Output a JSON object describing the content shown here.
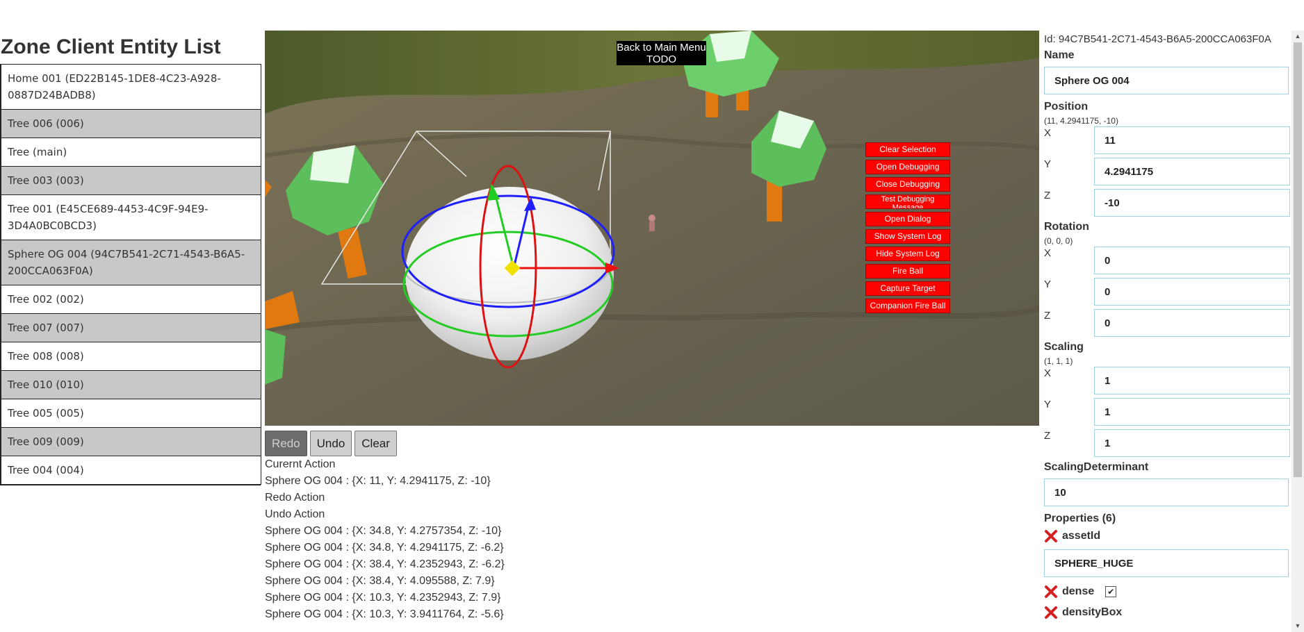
{
  "left": {
    "title": "Zone Client Entity List",
    "entities": [
      {
        "label": "Home 001 (ED22B145-1DE8-4C23-A928-0887D24BADB8)"
      },
      {
        "label": "Tree 006 (006)"
      },
      {
        "label": "Tree (main)"
      },
      {
        "label": "Tree 003 (003)"
      },
      {
        "label": "Tree 001 (E45CE689-4453-4C9F-94E9-3D4A0BC0BCD3)"
      },
      {
        "label": "Sphere OG 004 (94C7B541-2C71-4543-B6A5-200CCA063F0A)"
      },
      {
        "label": "Tree 002 (002)"
      },
      {
        "label": "Tree 007 (007)"
      },
      {
        "label": "Tree 008 (008)"
      },
      {
        "label": "Tree 010 (010)"
      },
      {
        "label": "Tree 005 (005)"
      },
      {
        "label": "Tree 009 (009)"
      },
      {
        "label": "Tree 004 (004)"
      }
    ]
  },
  "viewport": {
    "back_button": "Back to Main Menu TODO",
    "debug_buttons": [
      "Clear Selection",
      "Open Debugging",
      "Close Debugging",
      "Test Debugging Message",
      "Open Dialog",
      "Show System Log",
      "Hide System Log",
      "Fire Ball",
      "Capture Target",
      "Companion Fire Ball"
    ]
  },
  "actions": {
    "redo_label": "Redo",
    "undo_label": "Undo",
    "clear_label": "Clear",
    "log": [
      "Curernt Action",
      "Sphere OG 004 : {X: 11, Y: 4.2941175, Z: -10}",
      "Redo Action",
      "Undo Action",
      "Sphere OG 004 : {X: 34.8, Y: 4.2757354, Z: -10}",
      "Sphere OG 004 : {X: 34.8, Y: 4.2941175, Z: -6.2}",
      "Sphere OG 004 : {X: 38.4, Y: 4.2352943, Z: -6.2}",
      "Sphere OG 004 : {X: 38.4, Y: 4.095588, Z: 7.9}",
      "Sphere OG 004 : {X: 10.3, Y: 4.2352943, Z: 7.9}",
      "Sphere OG 004 : {X: 10.3, Y: 3.9411764, Z: -5.6}"
    ]
  },
  "inspector": {
    "id_text": "Id: 94C7B541-2C71-4543-B6A5-200CCA063F0A",
    "name_label": "Name",
    "name_value": "Sphere OG 004",
    "position": {
      "label": "Position",
      "summary": "(11, 4.2941175, -10)",
      "x": "11",
      "y": "4.2941175",
      "z": "-10"
    },
    "rotation": {
      "label": "Rotation",
      "summary": "(0, 0, 0)",
      "x": "0",
      "y": "0",
      "z": "0"
    },
    "scaling": {
      "label": "Scaling",
      "summary": "(1, 1, 1)",
      "x": "1",
      "y": "1",
      "z": "1"
    },
    "axis_x": "X",
    "axis_y": "Y",
    "axis_z": "Z",
    "scaling_determinant_label": "ScalingDeterminant",
    "scaling_determinant_value": "10",
    "properties_label": "Properties (6)",
    "properties": [
      {
        "key": "assetId",
        "value": "SPHERE_HUGE"
      },
      {
        "key": "dense",
        "checked": true
      },
      {
        "key": "densityBox"
      }
    ]
  },
  "colors": {
    "debug_red": "#ff0000",
    "input_border": "#9fd3e3",
    "list_alt_row": "#c8c8c8"
  }
}
